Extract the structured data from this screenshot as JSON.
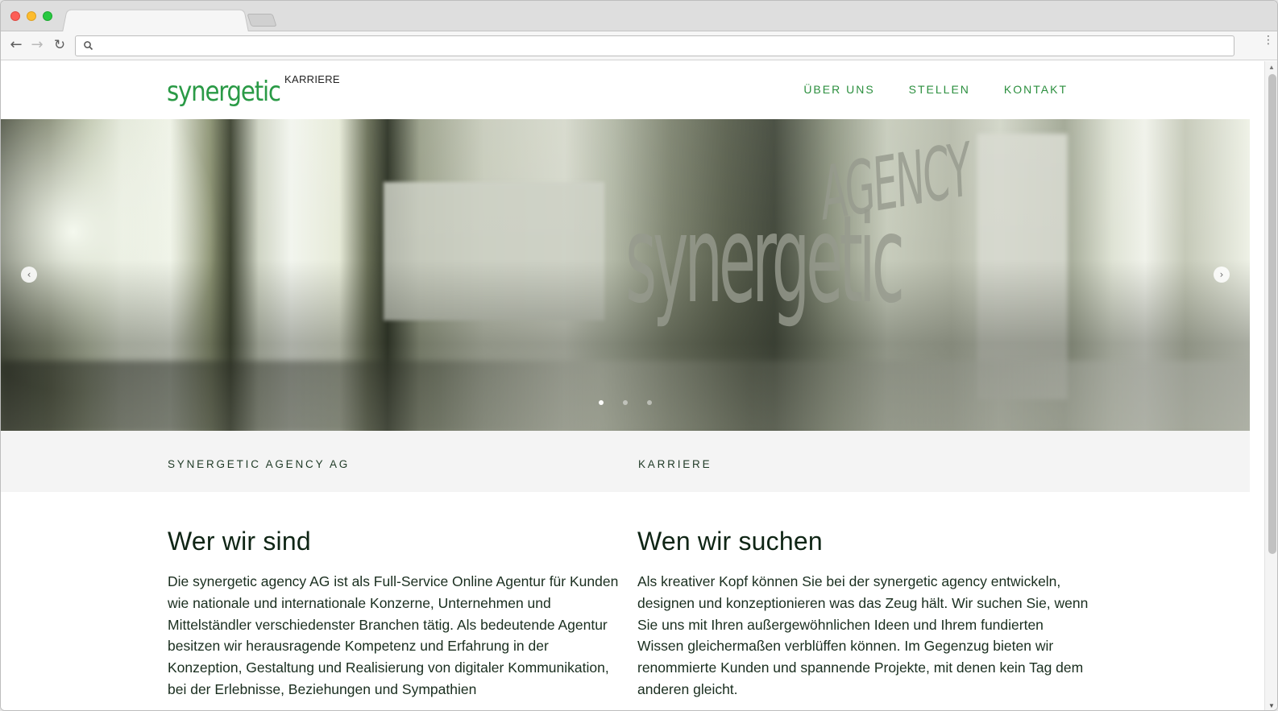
{
  "browser": {
    "url": "",
    "tabs": [
      {
        "title": ""
      }
    ]
  },
  "header": {
    "logo_text": "synergetic",
    "logo_sub": "KARRIERE",
    "nav": [
      {
        "label": "ÜBER UNS"
      },
      {
        "label": "STELLEN"
      },
      {
        "label": "KONTAKT"
      }
    ]
  },
  "hero": {
    "signage_word": "synergetic",
    "signage_word2": "AGENCY",
    "slides_count": 3,
    "active_slide": 1,
    "prev_icon": "chevron-left-icon",
    "next_icon": "chevron-right-icon"
  },
  "band": {
    "left_label": "SYNERGETIC AGENCY AG",
    "right_label": "KARRIERE"
  },
  "content": {
    "left": {
      "title": "Wer wir sind",
      "text": "Die synergetic agency AG ist als Full-Service Online Agentur für Kunden wie nationale und internationale Konzerne, Unternehmen und Mittelständler verschiedenster Branchen tätig. Als bedeutende Agentur besitzen wir herausragende Kompetenz und Erfahrung in der Konzeption, Gestaltung und Realisierung von digitaler Kommunikation, bei der Erlebnisse, Beziehungen und Sympathien"
    },
    "right": {
      "title": "Wen wir suchen",
      "text": "Als kreativer Kopf können Sie bei der synergetic agency entwickeln, designen und konzeptionieren was das Zeug hält. Wir suchen Sie, wenn Sie uns mit Ihren außergewöhnlichen Ideen und Ihrem fundierten Wissen gleichermaßen verblüffen können. Im Gegenzug bieten wir renommierte Kunden und spannende Projekte, mit denen kein Tag dem anderen gleicht."
    }
  },
  "colors": {
    "brand_green": "#2a9a46",
    "nav_green": "#2b8f3e",
    "band_bg": "#f4f4f4"
  }
}
